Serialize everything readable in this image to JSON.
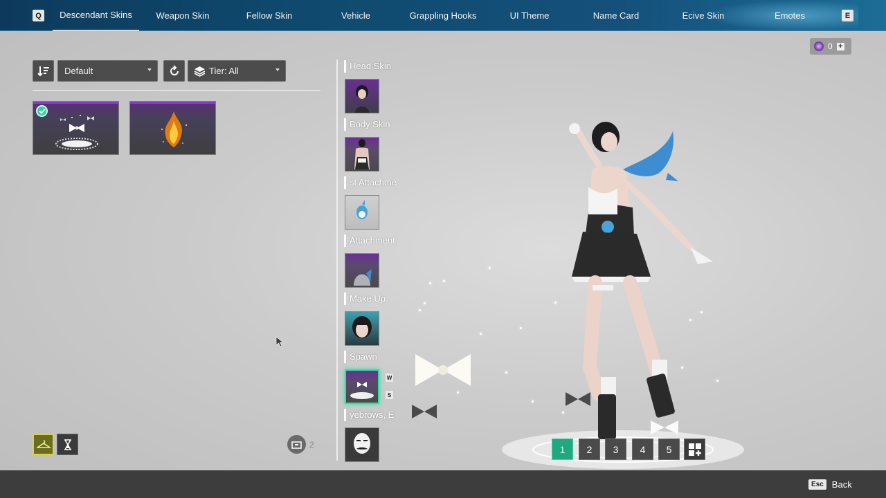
{
  "nav": {
    "prev_key": "Q",
    "next_key": "E",
    "tabs": [
      {
        "label": "Descendant Skins",
        "active": true
      },
      {
        "label": "Weapon Skin"
      },
      {
        "label": "Fellow Skin"
      },
      {
        "label": "Vehicle"
      },
      {
        "label": "Grappling Hooks"
      },
      {
        "label": "UI Theme"
      },
      {
        "label": "Name Card"
      },
      {
        "label": "Ecive Skin"
      },
      {
        "label": "Emotes"
      }
    ]
  },
  "currency": {
    "icon": "currency-coin-icon",
    "value": "0"
  },
  "toolbar": {
    "sort_label": "Default",
    "tier_label": "Tier: All"
  },
  "items": [
    {
      "name": "spawn-bow-effect",
      "equipped": true
    },
    {
      "name": "spawn-fire-effect",
      "equipped": false
    }
  ],
  "slots": [
    {
      "label": "Head Skin"
    },
    {
      "label": "Body Skin"
    },
    {
      "label": "st Attachme"
    },
    {
      "label": "Attachment"
    },
    {
      "label": "Make Up"
    },
    {
      "label": "Spawn",
      "selected": true,
      "keys": [
        "W",
        "S"
      ]
    },
    {
      "label": "yebrows, E"
    }
  ],
  "storage_count": "2",
  "presets": [
    "1",
    "2",
    "3",
    "4",
    "5"
  ],
  "active_preset": "1",
  "back": {
    "key": "Esc",
    "label": "Back"
  },
  "colors": {
    "accent": "#2fe0a5",
    "nav_bg": "#0f4a6e",
    "rarity": "#8a3cd0"
  }
}
